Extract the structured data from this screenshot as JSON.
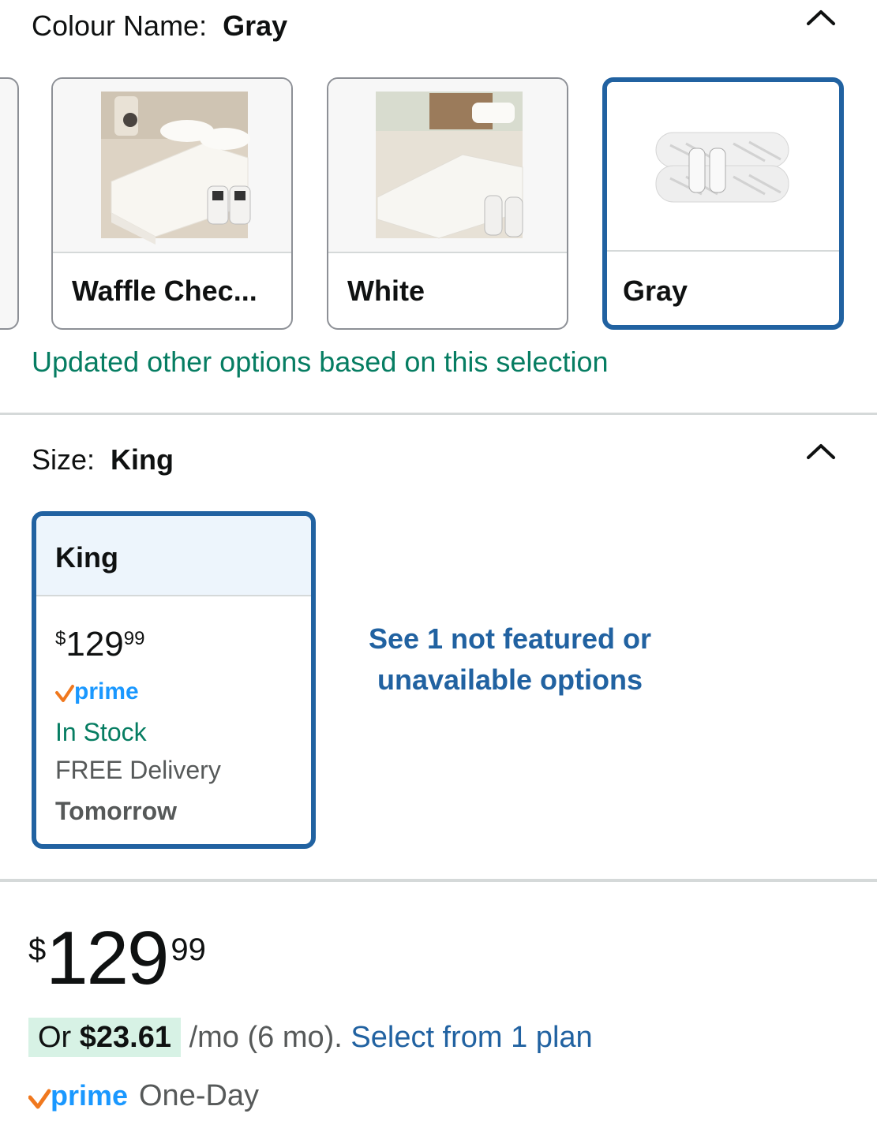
{
  "colour": {
    "label": "Colour Name:",
    "selected": "Gray",
    "swatches": [
      {
        "label": "Waffle Chec..."
      },
      {
        "label": "White"
      },
      {
        "label": "Gray"
      }
    ],
    "update_message": "Updated other options based on this selection"
  },
  "size": {
    "label": "Size:",
    "selected": "King",
    "card": {
      "title": "King",
      "price_symbol": "$",
      "price_whole": "129",
      "price_cents": "99",
      "prime": "prime",
      "stock": "In Stock",
      "delivery": "FREE Delivery",
      "delivery_day": "Tomorrow"
    },
    "not_featured": "See 1 not featured or unavailable options"
  },
  "price": {
    "symbol": "$",
    "whole": "129",
    "cents": "99",
    "installment_prefix": "Or",
    "installment_amount": "$23.61",
    "installment_suffix": "/mo (6 mo).",
    "installment_link": "Select from 1 plan",
    "prime": "prime",
    "prime_speed": "One-Day"
  },
  "colors": {
    "selected_border": "#2162a1",
    "success_green": "#067d62",
    "link_blue": "#2162a1",
    "prime_blue": "#1a98ff",
    "prime_check": "#f0781e"
  }
}
